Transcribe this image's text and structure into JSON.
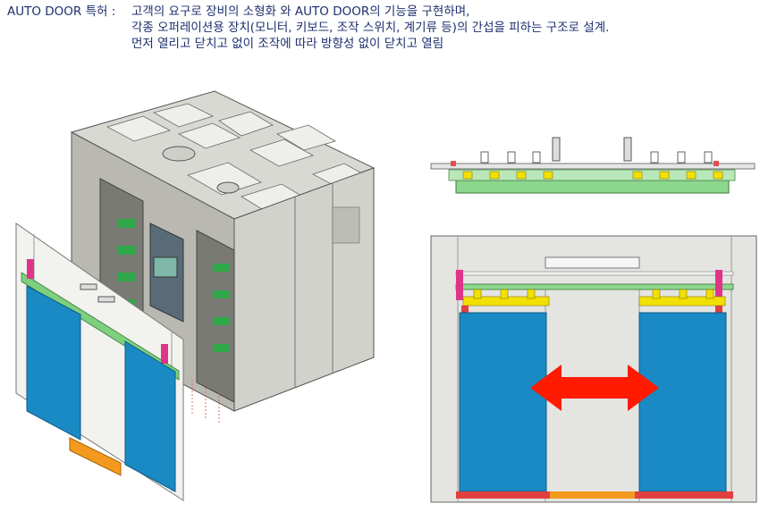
{
  "header": {
    "label": "AUTO DOOR 특허 :",
    "lines": [
      "고객의 요구로 장비의 소형화 와 AUTO DOOR의 기능을 구현하며,",
      "각종 오퍼레이션용 장치(모니터, 키보드, 조작 스위치, 계기류 등)의 간섭을 피하는 구조로 설계.",
      "먼저 열리고 닫치고 없이 조작에 따라 방향성 없이 닫치고 열림"
    ]
  },
  "colors": {
    "text": "#1f2f6e",
    "door_panel": "#1a8ac4",
    "arrow": "#ff1a00",
    "rail_green": "#7ed07e",
    "rail_yellow": "#f2e000",
    "magenta": "#e0338a",
    "orange": "#f39a1e"
  }
}
